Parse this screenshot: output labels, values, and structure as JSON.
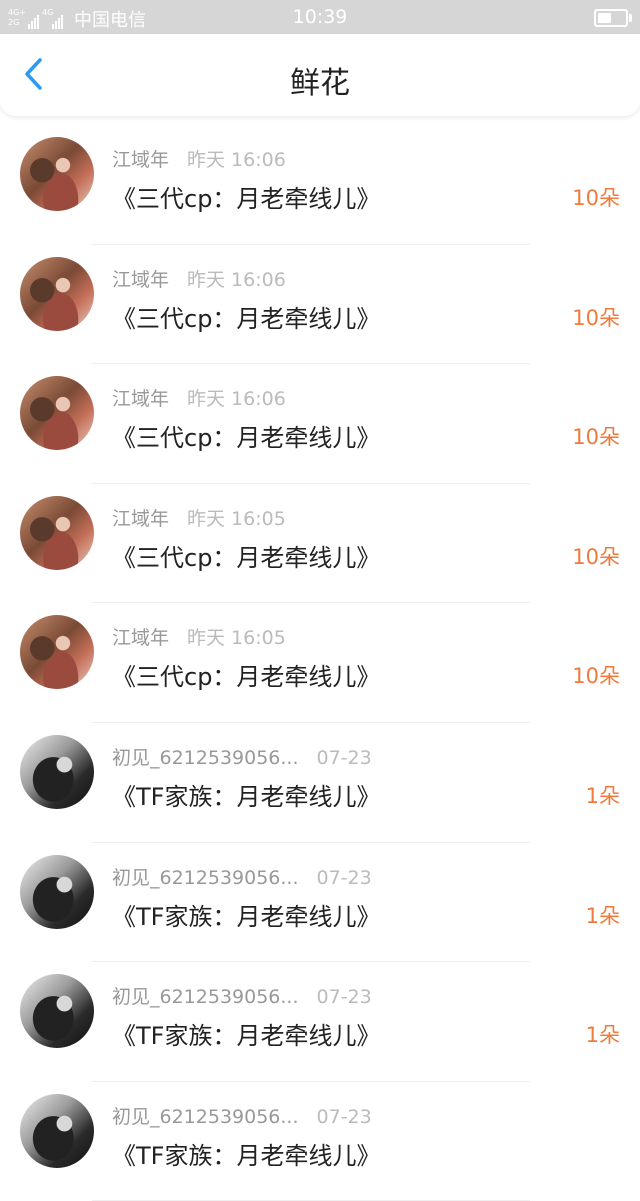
{
  "status_bar": {
    "network_top": "4G+",
    "network_bottom": "2G",
    "network_top_2": "4G",
    "carrier": "中国电信",
    "time": "10:39",
    "battery_level": 0.55
  },
  "header": {
    "back_icon": "chevron-left-icon",
    "title": "鲜花"
  },
  "accent_color": "#f07a3c",
  "items": [
    {
      "user": "江域年",
      "time": "昨天 16:06",
      "title": "《三代cp：月老牵线儿》",
      "count": "10朵",
      "avatar": "warm"
    },
    {
      "user": "江域年",
      "time": "昨天 16:06",
      "title": "《三代cp：月老牵线儿》",
      "count": "10朵",
      "avatar": "warm"
    },
    {
      "user": "江域年",
      "time": "昨天 16:06",
      "title": "《三代cp：月老牵线儿》",
      "count": "10朵",
      "avatar": "warm"
    },
    {
      "user": "江域年",
      "time": "昨天 16:05",
      "title": "《三代cp：月老牵线儿》",
      "count": "10朵",
      "avatar": "warm"
    },
    {
      "user": "江域年",
      "time": "昨天 16:05",
      "title": "《三代cp：月老牵线儿》",
      "count": "10朵",
      "avatar": "warm"
    },
    {
      "user": "初见_6212539056...",
      "time": "07-23",
      "title": "《TF家族：月老牵线儿》",
      "count": "1朵",
      "avatar": "dark"
    },
    {
      "user": "初见_6212539056...",
      "time": "07-23",
      "title": "《TF家族：月老牵线儿》",
      "count": "1朵",
      "avatar": "dark"
    },
    {
      "user": "初见_6212539056...",
      "time": "07-23",
      "title": "《TF家族：月老牵线儿》",
      "count": "1朵",
      "avatar": "dark"
    },
    {
      "user": "初见_6212539056...",
      "time": "07-23",
      "title": "《TF家族：月老牵线儿》",
      "count": "",
      "avatar": "dark"
    }
  ]
}
